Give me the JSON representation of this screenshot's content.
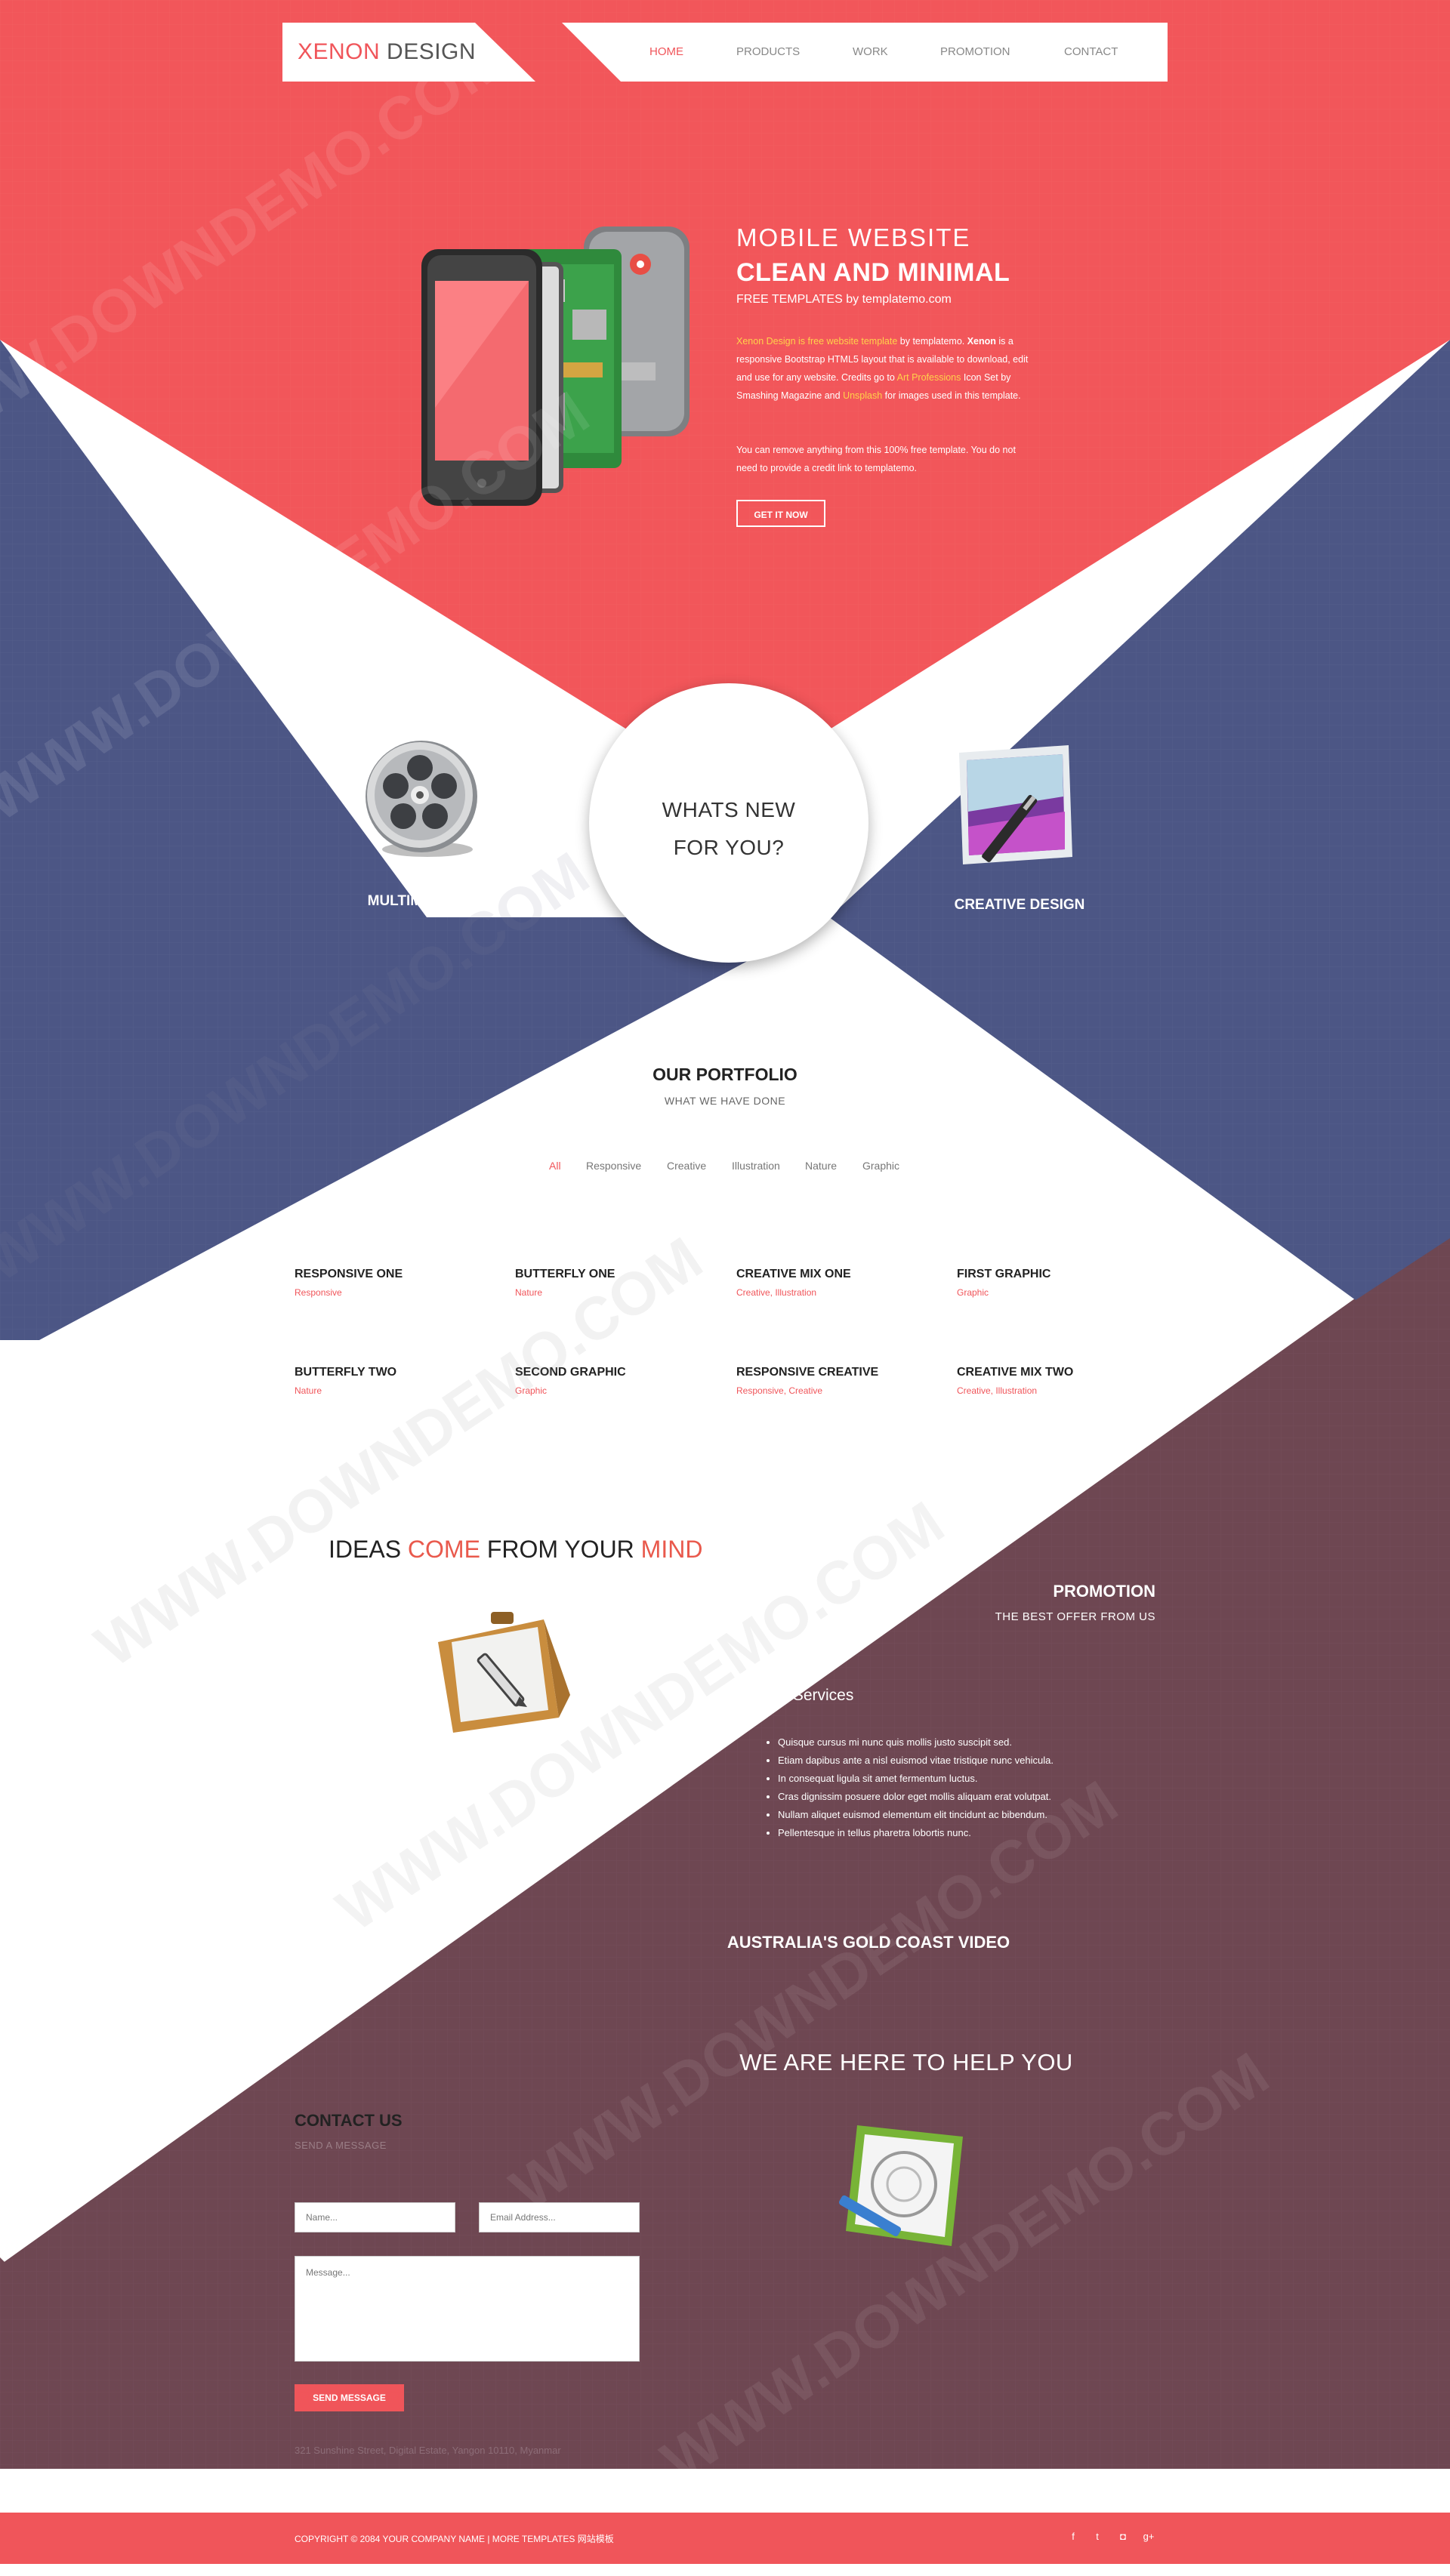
{
  "brand": {
    "first": "XENON",
    "second": "DESIGN"
  },
  "nav": [
    "HOME",
    "PRODUCTS",
    "WORK",
    "PROMOTION",
    "CONTACT"
  ],
  "hero": {
    "title1": "MOBILE WEBSITE",
    "title2": "CLEAN AND MINIMAL",
    "subtitle": "FREE TEMPLATES by templatemo.com",
    "p1": {
      "link1": "Xenon Design is free website template",
      "t1": " by templatemo. ",
      "bold": "Xenon",
      "t2": " is a responsive Bootstrap HTML5 layout that is available to download, edit and use for any website. Credits go to ",
      "link2": "Art Professions",
      "t3": " Icon Set by Smashing Magazine and ",
      "link3": "Unsplash",
      "t4": " for images used in this template."
    },
    "p2": "You can remove anything from this 100% free template. You do not need to provide a credit link to templatemo.",
    "button": "GET IT NOW"
  },
  "whats_new": {
    "line1": "WHATS NEW",
    "line2": "FOR YOU?"
  },
  "services": {
    "left": "MULTIMEDIA FILM",
    "right": "CREATIVE DESIGN"
  },
  "portfolio": {
    "title": "OUR PORTFOLIO",
    "subtitle": "WHAT WE HAVE DONE",
    "filters": [
      "All",
      "Responsive",
      "Creative",
      "Illustration",
      "Nature",
      "Graphic"
    ],
    "items": [
      {
        "title": "RESPONSIVE ONE",
        "tags": "Responsive"
      },
      {
        "title": "BUTTERFLY ONE",
        "tags": "Nature"
      },
      {
        "title": "CREATIVE MIX ONE",
        "tags": "Creative, Illustration"
      },
      {
        "title": "FIRST GRAPHIC",
        "tags": "Graphic"
      },
      {
        "title": "BUTTERFLY TWO",
        "tags": "Nature"
      },
      {
        "title": "SECOND GRAPHIC",
        "tags": "Graphic"
      },
      {
        "title": "RESPONSIVE CREATIVE",
        "tags": "Responsive, Creative"
      },
      {
        "title": "CREATIVE MIX TWO",
        "tags": "Creative, Illustration"
      }
    ]
  },
  "ideas": {
    "w1": "IDEAS ",
    "w2": "COME",
    "w3": " FROM YOUR ",
    "w4": "MIND"
  },
  "promotion": {
    "title": "PROMOTION",
    "subtitle": "THE BEST OFFER FROM US",
    "services_title": "Web Design Services",
    "list": [
      "Quisque cursus mi nunc quis mollis justo suscipit sed.",
      "Etiam dapibus ante a nisl euismod vitae tristique nunc vehicula.",
      "In consequat ligula sit amet fermentum luctus.",
      "Cras dignissim posuere dolor eget mollis aliquam erat volutpat.",
      "Nullam aliquet euismod elementum elit tincidunt ac bibendum.",
      "Pellentesque in tellus pharetra lobortis nunc."
    ]
  },
  "video_title": "AUSTRALIA'S GOLD COAST VIDEO",
  "help_title": "WE ARE HERE TO HELP YOU",
  "contact": {
    "title": "CONTACT US",
    "subtitle": "SEND A MESSAGE",
    "name_placeholder": "Name...",
    "email_placeholder": "Email Address...",
    "message_placeholder": "Message...",
    "send": "SEND MESSAGE",
    "address": "321 Sunshine Street, Digital Estate, Yangon 10110, Myanmar"
  },
  "footer": {
    "copyright": "COPYRIGHT © 2084 YOUR COMPANY NAME | MORE TEMPLATES 网站模板",
    "social": [
      "facebook-icon",
      "twitter-icon",
      "instagram-icon",
      "google-plus-icon"
    ],
    "social_glyphs": [
      "f",
      "t",
      "◘",
      "g+"
    ]
  },
  "colors": {
    "coral": "#f0555a",
    "navy": "#4c5685",
    "plum": "#6e4752",
    "yellow_link": "#ffd24a"
  },
  "watermark": "WWW.DOWNDEMO.COM"
}
